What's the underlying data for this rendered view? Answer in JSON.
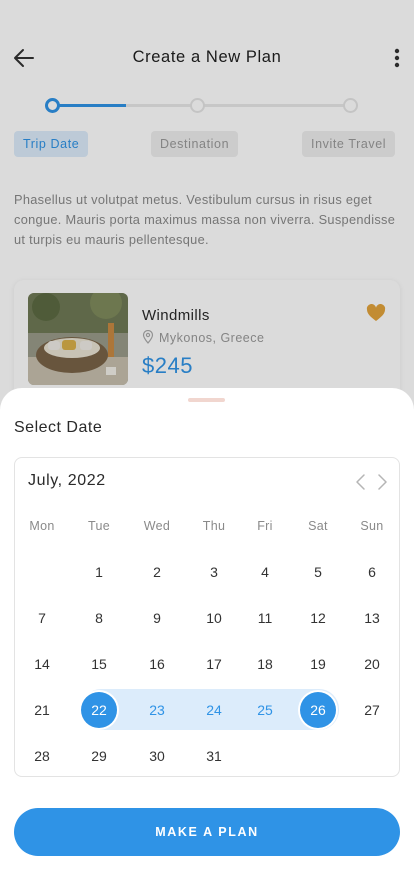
{
  "header": {
    "title": "Create a New Plan"
  },
  "stepper": {
    "steps": [
      {
        "label": "Trip Date"
      },
      {
        "label": "Destination"
      },
      {
        "label": "Invite Travel"
      }
    ]
  },
  "description": "Phasellus ut volutpat metus. Vestibulum cursus in risus eget congue. Mauris porta maximus massa non viverra. Suspendisse ut turpis eu mauris pellentesque.",
  "place": {
    "name": "Windmills",
    "location": "Mykonos, Greece",
    "price": "$245"
  },
  "sheet": {
    "title": "Select Date",
    "cta_label": "MAKE A PLAN"
  },
  "calendar": {
    "month_label": "July, 2022",
    "weekdays": [
      "Mon",
      "Tue",
      "Wed",
      "Thu",
      "Fri",
      "Sat",
      "Sun"
    ],
    "weeks": [
      [
        "",
        "1",
        "2",
        "3",
        "4",
        "5",
        "6"
      ],
      [
        "7",
        "8",
        "9",
        "10",
        "11",
        "12",
        "13"
      ],
      [
        "14",
        "15",
        "16",
        "17",
        "18",
        "19",
        "20"
      ],
      [
        "21",
        "22",
        "23",
        "24",
        "25",
        "26",
        "27"
      ],
      [
        "28",
        "29",
        "30",
        "31",
        "",
        "",
        ""
      ]
    ],
    "range_start": "22",
    "range_end": "26"
  },
  "colors": {
    "accent": "#2f93e6",
    "accent_light": "#dcecfb",
    "heart": "#e2a33c"
  },
  "icons": {
    "back": "arrow-left-icon",
    "more": "more-vertical-icon",
    "pin": "location-pin-icon",
    "heart": "heart-icon",
    "prev": "chevron-left-icon",
    "next": "chevron-right-icon"
  }
}
